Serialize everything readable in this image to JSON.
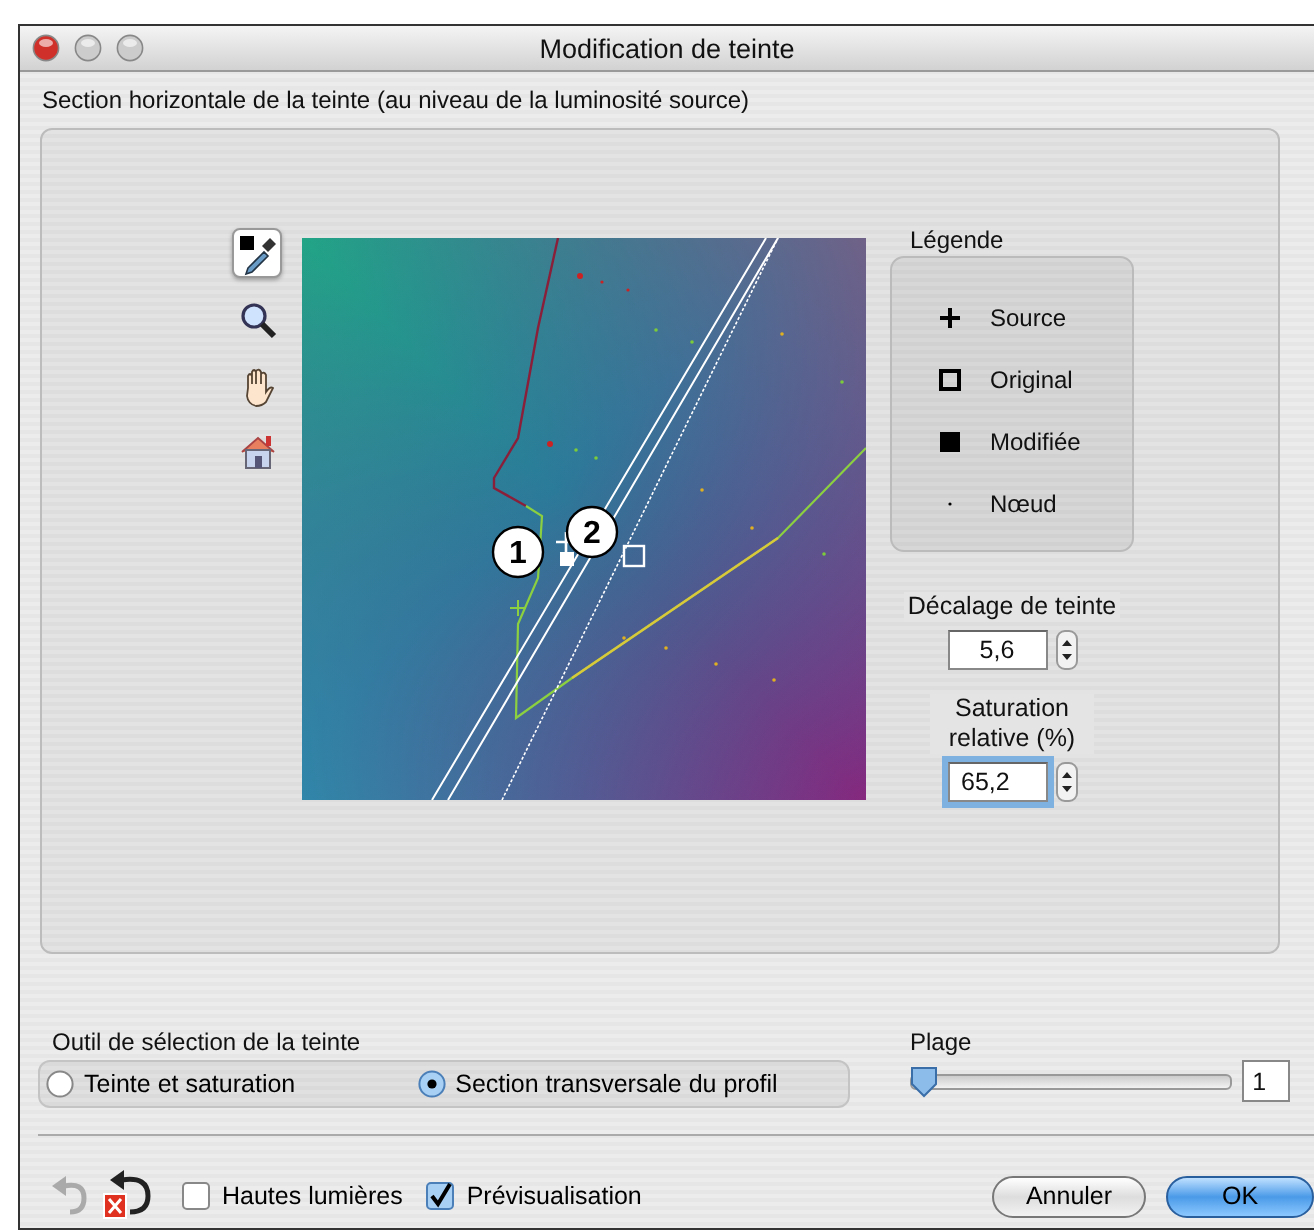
{
  "window": {
    "title": "Modification de teinte"
  },
  "section": {
    "label": "Section horizontale de la teinte (au niveau de la luminosité source)"
  },
  "tools": [
    {
      "kind": "eyedropper",
      "selected": true
    },
    {
      "kind": "zoom",
      "selected": false
    },
    {
      "kind": "hand",
      "selected": false
    },
    {
      "kind": "home",
      "selected": false
    }
  ],
  "plot": {
    "callouts": [
      "1",
      "2"
    ]
  },
  "legend": {
    "title": "Légende",
    "items": [
      {
        "kind": "source",
        "label": "Source"
      },
      {
        "kind": "original",
        "label": "Original"
      },
      {
        "kind": "modified",
        "label": "Modifiée"
      },
      {
        "kind": "node",
        "label": "Nœud"
      }
    ]
  },
  "hue_shift": {
    "label": "Décalage de teinte",
    "value": "5,6",
    "focused": false
  },
  "relative_saturation": {
    "label": "Saturation relative (%)",
    "value": "65,2",
    "focused": true
  },
  "selection_tool": {
    "label": "Outil de sélection de la teinte",
    "options": [
      {
        "label": "Teinte et saturation",
        "selected": false
      },
      {
        "label": "Section transversale du profil",
        "selected": true
      }
    ]
  },
  "range": {
    "label": "Plage",
    "level": 0,
    "value": "1"
  },
  "checkboxes": [
    {
      "label": "Hautes lumières",
      "checked": false
    },
    {
      "label": "Prévisualisation",
      "checked": true
    }
  ],
  "buttons": [
    {
      "label": "Annuler",
      "kind": "cancel"
    },
    {
      "label": "OK",
      "kind": "default"
    }
  ]
}
